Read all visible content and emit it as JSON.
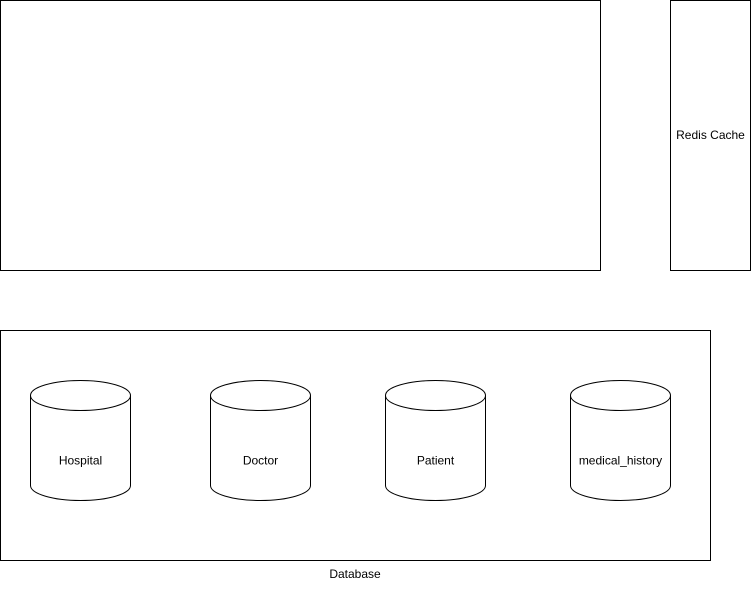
{
  "diagram": {
    "app_box": {
      "label": ""
    },
    "cache": {
      "label": "Redis Cache"
    },
    "database": {
      "label": "Database",
      "tables": [
        {
          "label": "Hospital"
        },
        {
          "label": "Doctor"
        },
        {
          "label": "Patient"
        },
        {
          "label": "medical_history"
        }
      ]
    }
  },
  "colors": {
    "stroke": "#000000",
    "fill": "#ffffff"
  }
}
